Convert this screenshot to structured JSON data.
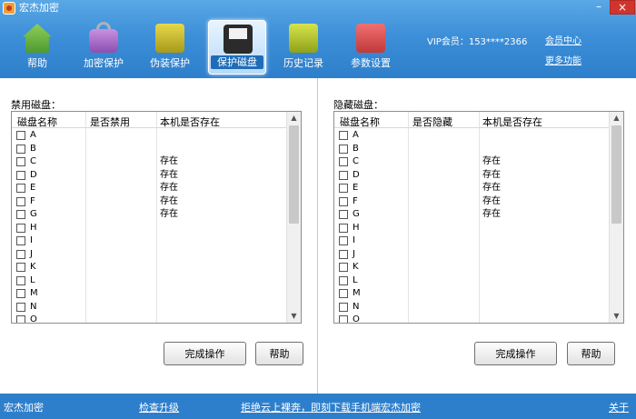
{
  "window": {
    "title": "宏杰加密",
    "minimize": "–",
    "close": "×"
  },
  "nav": [
    {
      "label": "帮助",
      "icon": "house-icon"
    },
    {
      "label": "加密保护",
      "icon": "lock-briefcase-icon"
    },
    {
      "label": "伪装保护",
      "icon": "book-icon"
    },
    {
      "label": "保护磁盘",
      "icon": "floppy-disk-icon",
      "active": true
    },
    {
      "label": "历史记录",
      "icon": "history-icon"
    },
    {
      "label": "参数设置",
      "icon": "tools-icon"
    }
  ],
  "account": {
    "vip_label": "VIP会员：",
    "vip_id": "153****2366",
    "member_center": "会员中心",
    "more_features": "更多功能"
  },
  "left_panel": {
    "title": "禁用磁盘：",
    "columns": [
      "磁盘名称",
      "是否禁用",
      "本机是否存在"
    ],
    "rows": [
      {
        "name": "A",
        "exists": ""
      },
      {
        "name": "B",
        "exists": ""
      },
      {
        "name": "C",
        "exists": "存在"
      },
      {
        "name": "D",
        "exists": "存在"
      },
      {
        "name": "E",
        "exists": "存在"
      },
      {
        "name": "F",
        "exists": "存在"
      },
      {
        "name": "G",
        "exists": "存在"
      },
      {
        "name": "H",
        "exists": ""
      },
      {
        "name": "I",
        "exists": ""
      },
      {
        "name": "J",
        "exists": ""
      },
      {
        "name": "K",
        "exists": ""
      },
      {
        "name": "L",
        "exists": ""
      },
      {
        "name": "M",
        "exists": ""
      },
      {
        "name": "N",
        "exists": ""
      },
      {
        "name": "O",
        "exists": ""
      }
    ],
    "done_button": "完成操作",
    "help_button": "帮助"
  },
  "right_panel": {
    "title": "隐藏磁盘：",
    "columns": [
      "磁盘名称",
      "是否隐藏",
      "本机是否存在"
    ],
    "rows": [
      {
        "name": "A",
        "exists": ""
      },
      {
        "name": "B",
        "exists": ""
      },
      {
        "name": "C",
        "exists": "存在"
      },
      {
        "name": "D",
        "exists": "存在"
      },
      {
        "name": "E",
        "exists": "存在"
      },
      {
        "name": "F",
        "exists": "存在"
      },
      {
        "name": "G",
        "exists": "存在"
      },
      {
        "name": "H",
        "exists": ""
      },
      {
        "name": "I",
        "exists": ""
      },
      {
        "name": "J",
        "exists": ""
      },
      {
        "name": "K",
        "exists": ""
      },
      {
        "name": "L",
        "exists": ""
      },
      {
        "name": "M",
        "exists": ""
      },
      {
        "name": "N",
        "exists": ""
      },
      {
        "name": "O",
        "exists": ""
      }
    ],
    "done_button": "完成操作",
    "help_button": "帮助"
  },
  "footer": {
    "brand": "宏杰加密",
    "check_update": "检查升级",
    "promo": "拒绝云上裸奔，即刻下载手机端宏杰加密",
    "about": "关于"
  },
  "scroll": {
    "up_arrow": "▲",
    "down_arrow": "▼"
  },
  "colors": {
    "header": "#3d8fd8",
    "footer": "#2e7fcb",
    "close": "#d0352d"
  }
}
